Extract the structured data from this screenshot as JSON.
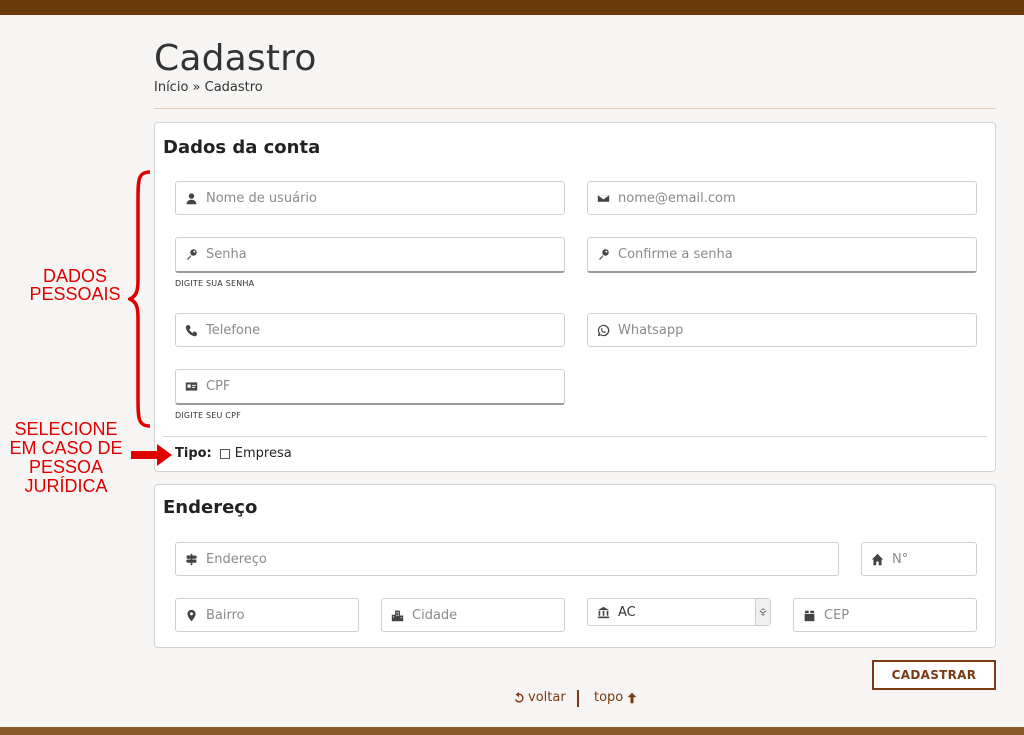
{
  "page": {
    "title": "Cadastro",
    "breadcrumb": "Início » Cadastro"
  },
  "account": {
    "heading": "Dados da conta",
    "username_placeholder": "Nome de usuário",
    "email_placeholder": "nome@email.com",
    "password_placeholder": "Senha",
    "password_hint": "DIGITE SUA SENHA",
    "confirm_password_placeholder": "Confirme a senha",
    "phone_placeholder": "Telefone",
    "whatsapp_placeholder": "Whatsapp",
    "cpf_placeholder": "CPF",
    "cpf_hint": "DIGITE SEU CPF",
    "tipo_label": "Tipo:",
    "tipo_option": "Empresa"
  },
  "address": {
    "heading": "Endereço",
    "address_placeholder": "Endereço",
    "number_placeholder": "N°",
    "district_placeholder": "Bairro",
    "city_placeholder": "Cidade",
    "state_selected": "AC",
    "cep_placeholder": "CEP"
  },
  "actions": {
    "submit_label": "CADASTRAR",
    "back_label": "voltar",
    "top_label": "topo"
  },
  "annotations": {
    "personal_line1": "DADOS",
    "personal_line2": "PESSOAIS",
    "select_line1": "SELECIONE",
    "select_line2": "EM CASO DE",
    "select_line3": "PESSOA",
    "select_line4": "JURÍDICA"
  },
  "colors": {
    "topbar": "#6b3a0c",
    "accent": "#7a3a14",
    "annotation": "#e00000"
  }
}
